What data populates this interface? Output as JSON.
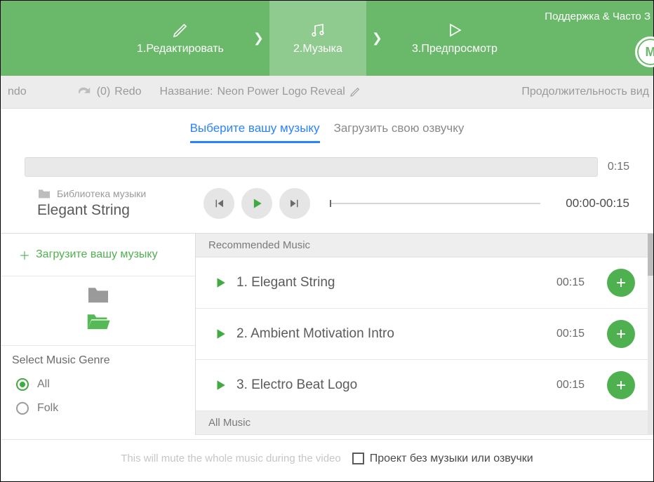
{
  "header": {
    "steps": [
      {
        "label": "1.Редактировать"
      },
      {
        "label": "2.Музыка"
      },
      {
        "label": "3.Предпросмотр"
      }
    ],
    "support": "Поддержка & Часто З",
    "circle_button": "М"
  },
  "toolbar": {
    "undo_fragment": "ndo",
    "redo_count": "(0)",
    "redo_label": "Redo",
    "title_label": "Название:",
    "title_value": "Neon Power Logo Reveal",
    "duration": "Продолжительность вид"
  },
  "tabs": {
    "select": "Выберите вашу музыку",
    "upload": "Загрузить свою озвучку"
  },
  "timeline": {
    "end": "0:15"
  },
  "library": {
    "label": "Библиотека музыки",
    "current_track": "Elegant String",
    "time_range": "00:00-00:15"
  },
  "sidebar": {
    "upload": "Загрузите вашу музыку",
    "genre_head": "Select Music Genre",
    "genres": [
      "All",
      "Folk"
    ]
  },
  "music": {
    "recommended_head": "Recommended Music",
    "all_head": "All Music",
    "tracks": [
      {
        "name": "1. Elegant String",
        "dur": "00:15"
      },
      {
        "name": "2. Ambient Motivation Intro",
        "dur": "00:15"
      },
      {
        "name": "3. Electro Beat Logo",
        "dur": "00:15"
      }
    ]
  },
  "footer": {
    "hint": "This will mute the whole music during the video",
    "checkbox_label": "Проект без музыки или озвучки"
  }
}
